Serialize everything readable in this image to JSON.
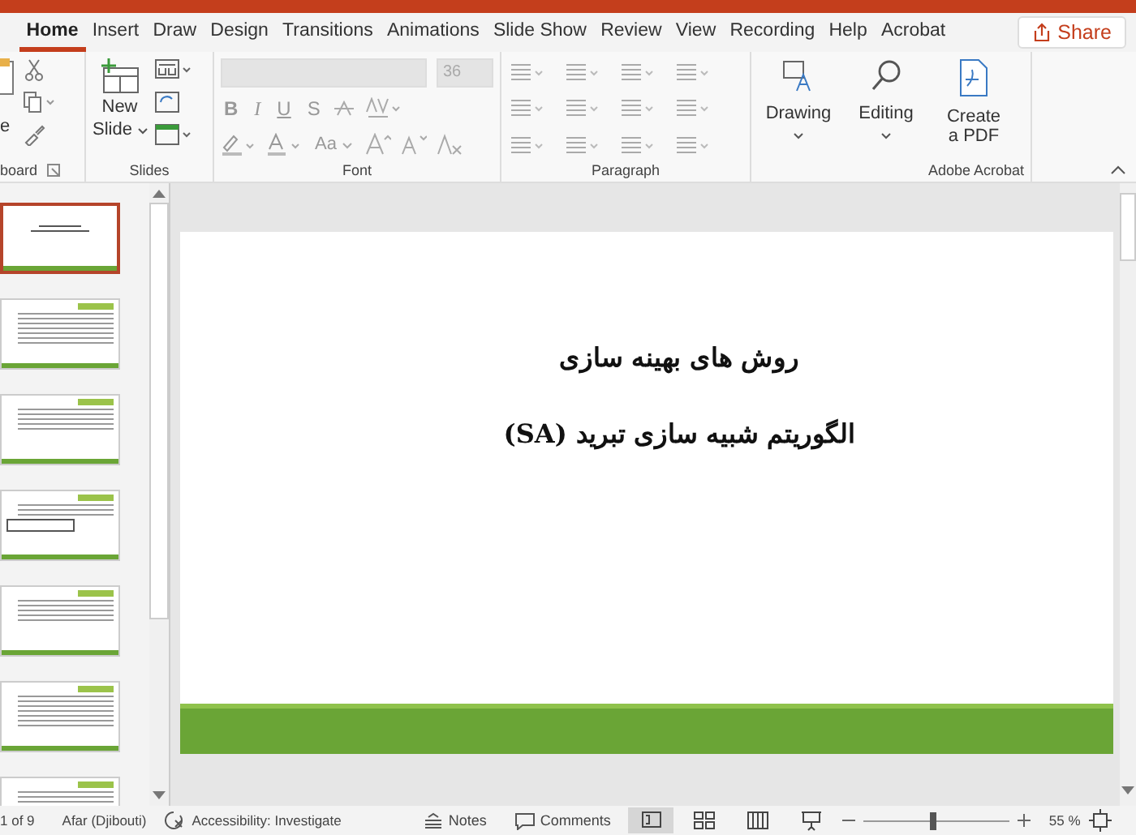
{
  "tabs": [
    {
      "label": "Home",
      "selected": true
    },
    {
      "label": "Insert",
      "selected": false
    },
    {
      "label": "Draw",
      "selected": false
    },
    {
      "label": "Design",
      "selected": false
    },
    {
      "label": "Transitions",
      "selected": false
    },
    {
      "label": "Animations",
      "selected": false
    },
    {
      "label": "Slide Show",
      "selected": false
    },
    {
      "label": "Review",
      "selected": false
    },
    {
      "label": "View",
      "selected": false
    },
    {
      "label": "Recording",
      "selected": false
    },
    {
      "label": "Help",
      "selected": false
    },
    {
      "label": "Acrobat",
      "selected": false
    }
  ],
  "share_button": "Share",
  "ribbon": {
    "clipboard": {
      "paste_label": "e",
      "group_label": "board"
    },
    "slides": {
      "new_slide_label": [
        "New",
        "Slide"
      ],
      "group_label": "Slides"
    },
    "font": {
      "font_size": "36",
      "format_buttons": [
        "B",
        "I",
        "U",
        "S"
      ],
      "case_button": "Aa",
      "group_label": "Font"
    },
    "paragraph": {
      "group_label": "Paragraph"
    },
    "large_buttons": [
      {
        "kind": "drawing",
        "label": "Drawing"
      },
      {
        "kind": "editing",
        "label": "Editing"
      },
      {
        "kind": "pdf",
        "label": "Create a PDF"
      }
    ],
    "acrobat_group_label": "Adobe Acrobat"
  },
  "thumbnails": [
    {
      "kind": "title",
      "selected": true
    },
    {
      "kind": "text",
      "selected": false
    },
    {
      "kind": "list",
      "selected": false
    },
    {
      "kind": "diagram",
      "selected": false
    },
    {
      "kind": "list",
      "selected": false
    },
    {
      "kind": "text",
      "selected": false
    },
    {
      "kind": "text",
      "selected": false
    }
  ],
  "slide": {
    "title": "روش های بهینه سازی",
    "subtitle": "الگوریتم شبیه سازی تبرید (SA)"
  },
  "status_bar": {
    "slide_count": "1 of 9",
    "language": "Afar (Djibouti)",
    "accessibility": "Accessibility: Investigate",
    "notes": "Notes",
    "comments": "Comments",
    "zoom": "55 %",
    "zoom_slider": {
      "level": 0.45
    }
  }
}
